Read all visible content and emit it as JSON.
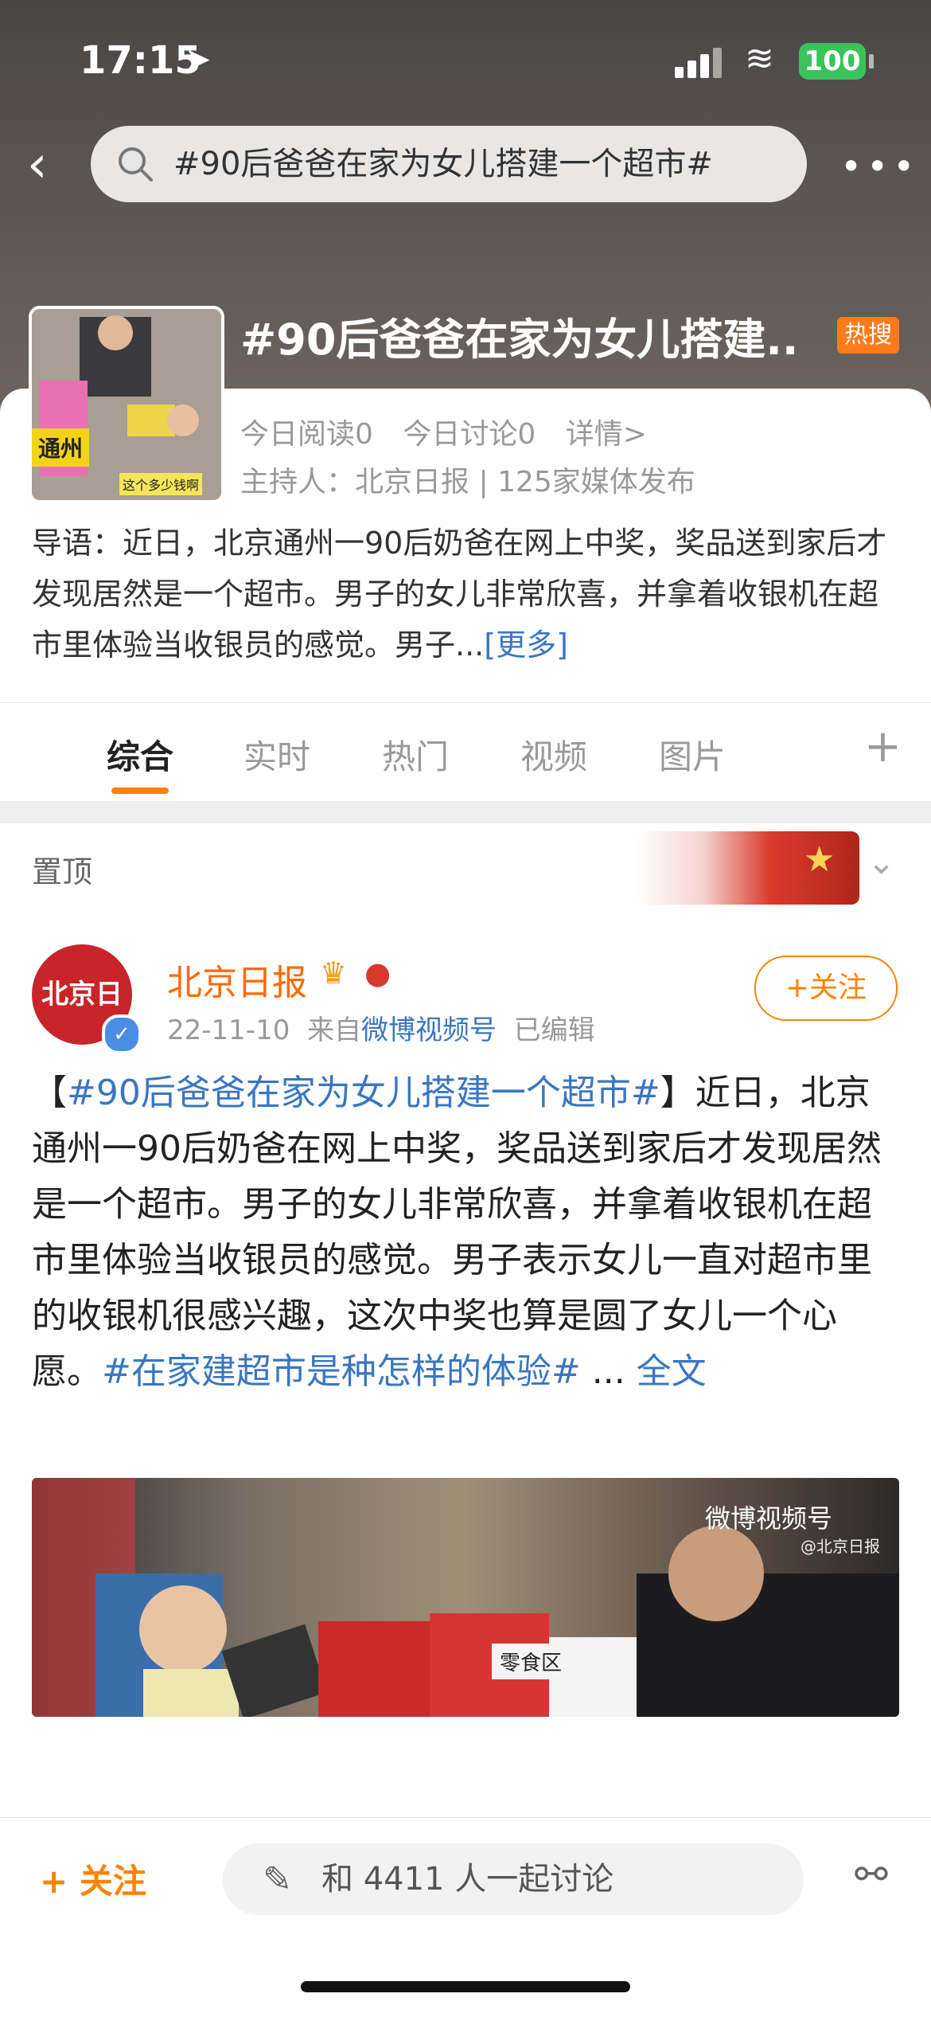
{
  "status_bar": {
    "time": "17:15",
    "battery": "100"
  },
  "search": {
    "query": "#90后爸爸在家为女儿搭建一个超市#"
  },
  "topic": {
    "title": "#90后爸爸在家为女儿搭建...",
    "hot_badge": "热搜",
    "thumb_tag": "通州",
    "thumb_caption": "这个多少钱啊",
    "stats": {
      "read": "今日阅读0",
      "discuss": "今日讨论0",
      "details": "详情>"
    },
    "host": "主持人：北京日报 | 125家媒体发布",
    "intro": "导语：近日，北京通州一90后奶爸在网上中奖，奖品送到家后才发现居然是一个超市。男子的女儿非常欣喜，并拿着收银机在超市里体验当收银员的感觉。男子...",
    "intro_more": "[更多]"
  },
  "tabs": [
    {
      "label": "综合",
      "active": true
    },
    {
      "label": "实时",
      "active": false
    },
    {
      "label": "热门",
      "active": false
    },
    {
      "label": "视频",
      "active": false
    },
    {
      "label": "图片",
      "active": false
    }
  ],
  "pinned": {
    "label": "置顶"
  },
  "post": {
    "avatar_text": "北京日报",
    "author": "北京日报",
    "date": "22-11-10",
    "source_prefix": "来自",
    "source": "微博视频号",
    "edited": "已编辑",
    "follow_label": "+关注",
    "text_open": "【",
    "tag1": "#90后爸爸在家为女儿搭建一个超市#",
    "text_body": "】近日，北京通州一90后奶爸在网上中奖，奖品送到家后才发现居然是一个超市。男子的女儿非常欣喜，并拿着收银机在超市里体验当收银员的感觉。男子表示女儿一直对超市里的收银机很感兴趣，这次中奖也算是圆了女儿一个心愿。",
    "tag2": "#在家建超市是种怎样的体验#",
    "ellipsis": " ... ",
    "full_text": "全文",
    "video_watermark": "微博视频号",
    "video_watermark_sub": "@北京日报",
    "video_sign": "零食区"
  },
  "bottom_bar": {
    "follow": "+ 关注",
    "discuss": "和 4411 人一起讨论"
  },
  "colors": {
    "accent": "#ff8200",
    "link": "#3a76c2",
    "hot": "#ff7a1a"
  },
  "icons": [
    "location-arrow-icon",
    "signal-icon",
    "wifi-icon",
    "battery-icon",
    "back-icon",
    "search-icon",
    "more-icon",
    "plus-icon",
    "chevron-down-icon",
    "verified-icon",
    "edit-icon",
    "share-icon"
  ]
}
